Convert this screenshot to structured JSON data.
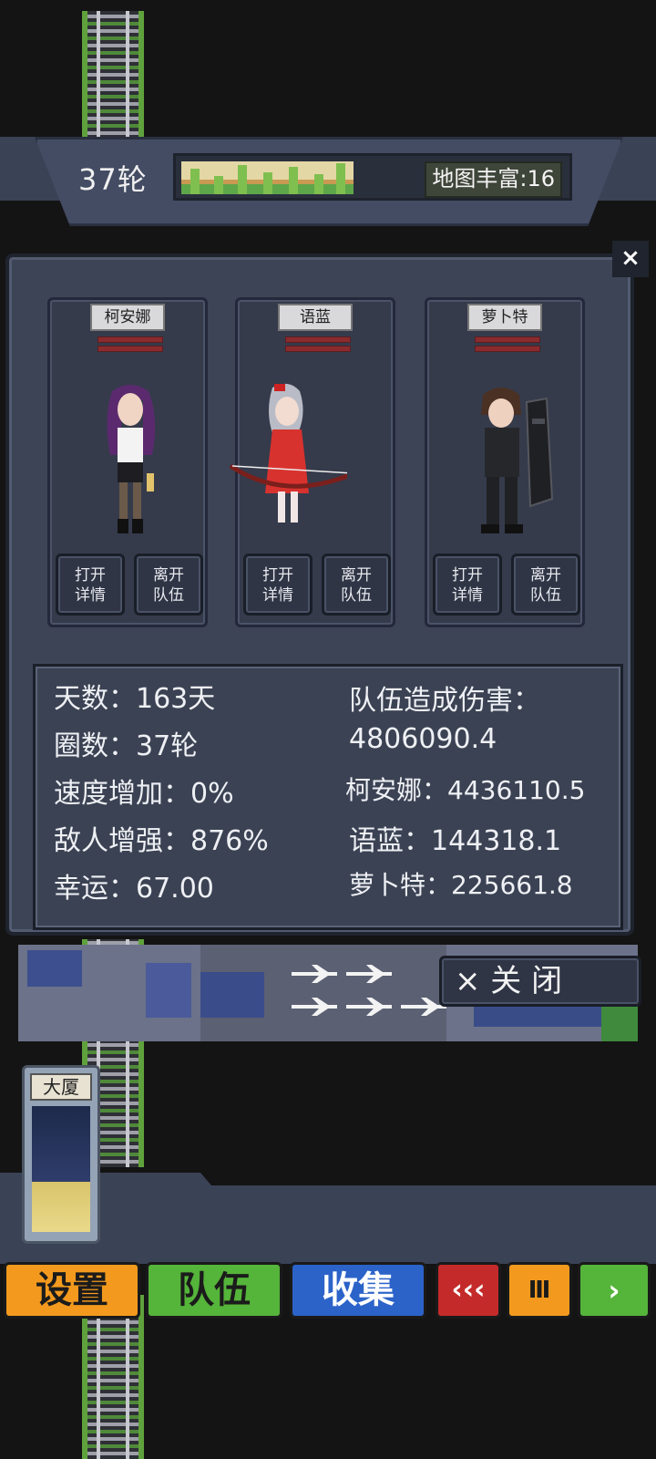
{
  "hud": {
    "round": "37轮",
    "map_richness_label": "地图丰富:16",
    "map_richness_progress": 0.45
  },
  "team_dialog": {
    "close_x": "×",
    "members": [
      {
        "name": "柯安娜",
        "open_details": [
          "打开",
          "详情"
        ],
        "leave_team": [
          "离开",
          "队伍"
        ]
      },
      {
        "name": "语蓝",
        "open_details": [
          "打开",
          "详情"
        ],
        "leave_team": [
          "离开",
          "队伍"
        ]
      },
      {
        "name": "萝卜特",
        "open_details": [
          "打开",
          "详情"
        ],
        "leave_team": [
          "离开",
          "队伍"
        ]
      }
    ],
    "stats": {
      "days": "天数：163天",
      "laps": "圈数：37轮",
      "speed": "速度增加：0%",
      "enemy": "敌人增强：876%",
      "luck": "幸运：67.00",
      "team_damage_label": "队伍造成伤害：",
      "team_damage_value": "4806090.4",
      "damage_1": "柯安娜：4436110.5",
      "damage_2": "语蓝：144318.1",
      "damage_3": "萝卜特：225661.8"
    },
    "close_button": "× 关    闭"
  },
  "building_card": {
    "label": "大厦"
  },
  "bottom_bar": {
    "settings": "设置",
    "team": "队伍",
    "collection": "收集",
    "rewind": "‹‹‹",
    "pause": "Ⅲ",
    "play": "›"
  },
  "colors": {
    "settings": "#f39a1e",
    "team": "#55b43a",
    "collection": "#2c63c9",
    "rewind": "#c52a2a",
    "pause": "#f39a1e",
    "play": "#55b43a"
  }
}
